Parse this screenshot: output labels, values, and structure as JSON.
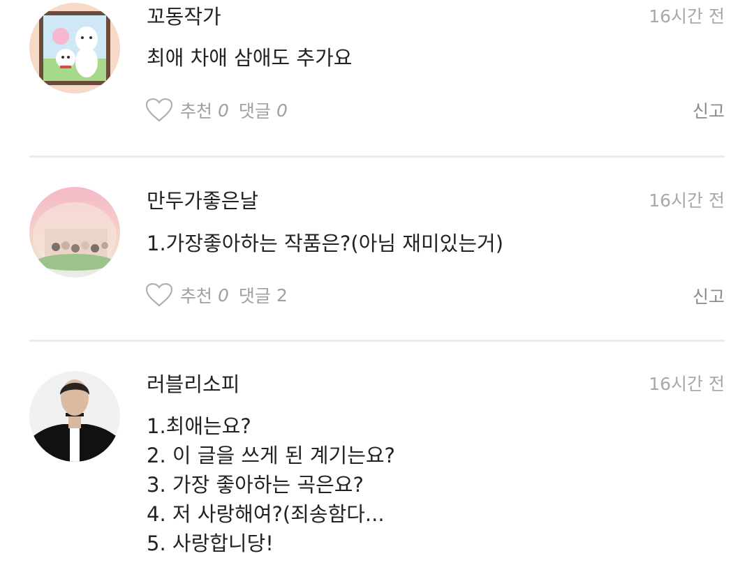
{
  "comments": [
    {
      "author": "꼬동작가",
      "time": "16시간 전",
      "body": "최애 차애 삼애도 추가요",
      "recommend_label": "추천",
      "recommend_count": "0",
      "reply_label": "댓글",
      "reply_count": "0",
      "report_label": "신고"
    },
    {
      "author": "만두가좋은날",
      "time": "16시간 전",
      "body": "1.가장좋아하는 작품은?(아님 재미있는거)",
      "recommend_label": "추천",
      "recommend_count": "0",
      "reply_label": "댓글",
      "reply_count": "2",
      "report_label": "신고"
    },
    {
      "author": "러블리소피",
      "time": "16시간 전",
      "body": "1.최애는요?\n2. 이 글을 쓰게 된 계기는요?\n3. 가장 좋아하는 곡은요?\n4. 저 사랑해여?(죄송함다...\n5. 사랑합니당!"
    }
  ]
}
